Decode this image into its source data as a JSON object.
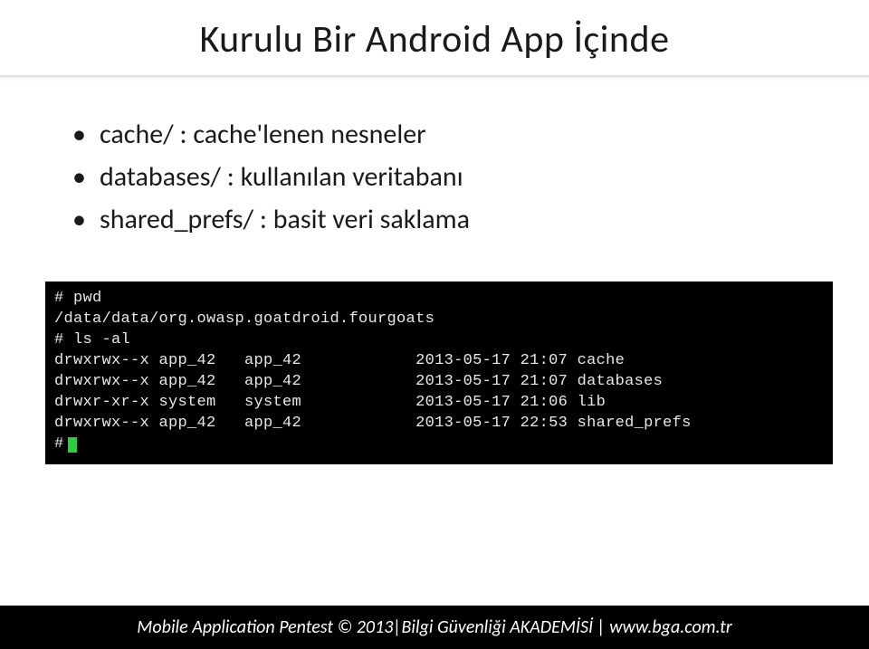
{
  "header": {
    "title": "Kurulu Bir Android App İçinde"
  },
  "bullets": {
    "item1": "cache/ : cache'lenen nesneler",
    "item2": "databases/ : kullanılan veritabanı",
    "item3": "shared_prefs/ : basit veri saklama"
  },
  "terminal": {
    "line1": "# pwd",
    "line2": "/data/data/org.owasp.goatdroid.fourgoats",
    "line3": "# ls -al",
    "line4": "drwxrwx--x app_42   app_42            2013-05-17 21:07 cache",
    "line5": "drwxrwx--x app_42   app_42            2013-05-17 21:07 databases",
    "line6": "drwxr-xr-x system   system            2013-05-17 21:06 lib",
    "line7": "drwxrwx--x app_42   app_42            2013-05-17 22:53 shared_prefs",
    "line8": "#"
  },
  "footer": {
    "text": "Mobile Application Pentest © 2013|Bilgi Güvenliği AKADEMİSİ | www.bga.com.tr"
  }
}
